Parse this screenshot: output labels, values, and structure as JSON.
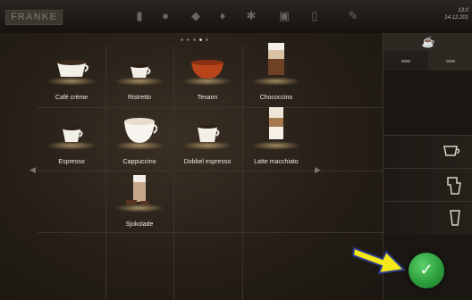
{
  "brand": "FRANKE",
  "datetime": {
    "time": "13:0",
    "date": "14.12.201"
  },
  "top_icons": [
    "bean-icon",
    "coffee-bean-icon",
    "grinder-icon",
    "drop-icon",
    "settings-icon",
    "monitor-icon",
    "door-icon",
    "wrench-icon"
  ],
  "pager": {
    "pages": 5,
    "active": 3
  },
  "products": [
    {
      "label": "Café crème",
      "icon": "cafe-creme-icon"
    },
    {
      "label": "Ristretto",
      "icon": "ristretto-icon"
    },
    {
      "label": "Tevann",
      "icon": "tea-icon"
    },
    {
      "label": "Chococcino",
      "icon": "chococcino-icon"
    },
    {
      "label": "Espresso",
      "icon": "espresso-icon"
    },
    {
      "label": "Cappuccino",
      "icon": "cappuccino-icon"
    },
    {
      "label": "Dobbel espresso",
      "icon": "double-espresso-icon"
    },
    {
      "label": "Latte macchiato",
      "icon": "latte-macchiato-icon"
    },
    {
      "label": "Sjokolade",
      "icon": "chocolate-icon"
    }
  ],
  "right_panel": {
    "top_icon": "cup-icon",
    "sizes": [
      "small-cup-icon",
      "large-cup-icon"
    ],
    "buttons": [
      "cup-with-saucer-icon",
      "glass-icon",
      "tall-glass-icon"
    ]
  },
  "confirm": "✓"
}
